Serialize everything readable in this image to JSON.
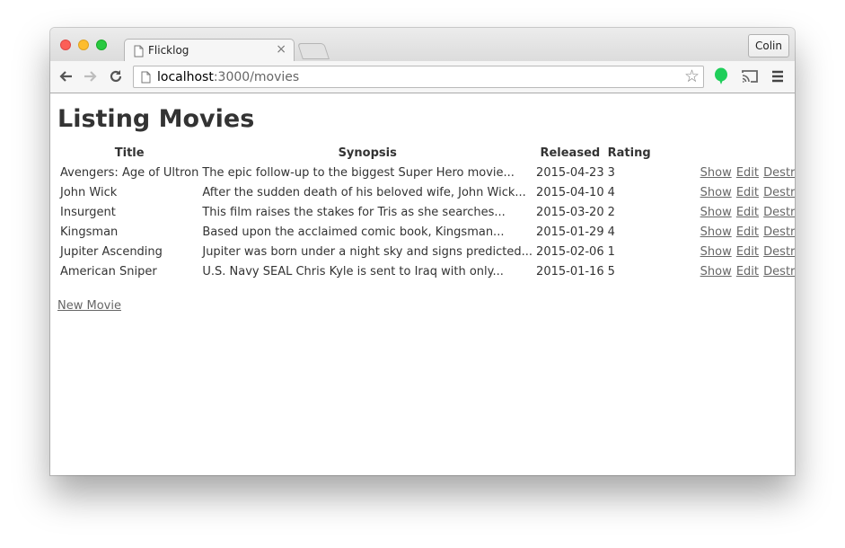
{
  "browser": {
    "tab_title": "Flicklog",
    "tab_close": "×",
    "profile_name": "Colin",
    "url_host": "localhost",
    "url_path": ":3000/movies",
    "star": "☆"
  },
  "page": {
    "heading": "Listing Movies",
    "columns": [
      "Title",
      "Synopsis",
      "Released",
      "Rating"
    ],
    "rows": [
      {
        "title": "Avengers: Age of Ultron",
        "synopsis": "The epic follow-up to the biggest Super Hero movie...",
        "released": "2015-04-23",
        "rating": "3"
      },
      {
        "title": "John Wick",
        "synopsis": "After the sudden death of his beloved wife, John Wick...",
        "released": "2015-04-10",
        "rating": "4"
      },
      {
        "title": "Insurgent",
        "synopsis": "This film raises the stakes for Tris as she searches...",
        "released": "2015-03-20",
        "rating": "2"
      },
      {
        "title": "Kingsman",
        "synopsis": "Based upon the acclaimed comic book, Kingsman...",
        "released": "2015-01-29",
        "rating": "4"
      },
      {
        "title": "Jupiter Ascending",
        "synopsis": "Jupiter was born under a night sky and signs predicted...",
        "released": "2015-02-06",
        "rating": "1"
      },
      {
        "title": "American Sniper",
        "synopsis": "U.S. Navy SEAL Chris Kyle is sent to Iraq with only...",
        "released": "2015-01-16",
        "rating": "5"
      }
    ],
    "row_actions": {
      "show": "Show",
      "edit": "Edit",
      "destroy": "Destroy"
    },
    "new_movie_link": "New Movie"
  },
  "colors": {
    "extension_icon": "#1fce5a",
    "link": "#666666",
    "text": "#333333"
  },
  "icons": {
    "back": "back-arrow-icon",
    "forward": "forward-arrow-icon",
    "reload": "reload-icon",
    "page": "page-icon",
    "bookmark": "star-icon",
    "extension": "evernote-extension-icon",
    "cast": "cast-icon",
    "menu": "hamburger-menu-icon"
  }
}
